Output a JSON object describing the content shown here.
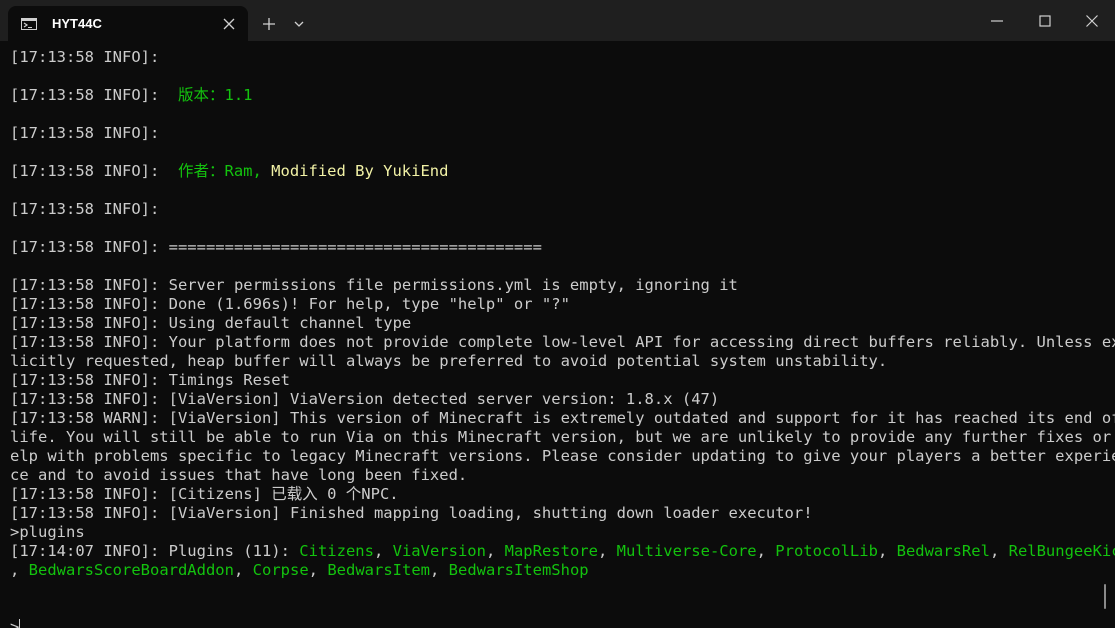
{
  "window": {
    "tab_title": "HYT44C",
    "icons": {
      "tab": "terminal-icon",
      "close_tab": "close-icon",
      "new_tab": "plus-icon",
      "dropdown": "chevron-down-icon",
      "minimize": "minimize-icon",
      "maximize": "maximize-icon",
      "close": "close-icon"
    }
  },
  "colors": {
    "background": "#0c0c0c",
    "titlebar": "#1f1f1f",
    "text": "#cccccc",
    "green": "#13c30e",
    "yellow": "#f2f2a6"
  },
  "terminal": {
    "lines": [
      [
        {
          "text": "[17:13:58 INFO]:"
        }
      ],
      [],
      [
        {
          "text": "[17:13:58 INFO]:  "
        },
        {
          "text": "版本：1.1",
          "color": "green"
        }
      ],
      [],
      [
        {
          "text": "[17:13:58 INFO]:"
        }
      ],
      [],
      [
        {
          "text": "[17:13:58 INFO]:  "
        },
        {
          "text": "作者：Ram, ",
          "color": "green"
        },
        {
          "text": "Modified By YukiEnd",
          "color": "yellow"
        }
      ],
      [],
      [
        {
          "text": "[17:13:58 INFO]:"
        }
      ],
      [],
      [
        {
          "text": "[17:13:58 INFO]: ========================================"
        }
      ],
      [],
      [
        {
          "text": "[17:13:58 INFO]: Server permissions file permissions.yml is empty, ignoring it"
        }
      ],
      [
        {
          "text": "[17:13:58 INFO]: Done (1.696s)! For help, type \"help\" or \"?\""
        }
      ],
      [
        {
          "text": "[17:13:58 INFO]: Using default channel type"
        }
      ],
      [
        {
          "text": "[17:13:58 INFO]: Your platform does not provide complete low-level API for accessing direct buffers reliably. Unless exp"
        }
      ],
      [
        {
          "text": "licitly requested, heap buffer will always be preferred to avoid potential system unstability."
        }
      ],
      [
        {
          "text": "[17:13:58 INFO]: Timings Reset"
        }
      ],
      [
        {
          "text": "[17:13:58 INFO]: [ViaVersion] ViaVersion detected server version: 1.8.x (47)"
        }
      ],
      [
        {
          "text": "[17:13:58 WARN]: [ViaVersion] This version of Minecraft is extremely outdated and support for it has reached its end of"
        }
      ],
      [
        {
          "text": "life. You will still be able to run Via on this Minecraft version, but we are unlikely to provide any further fixes or h"
        }
      ],
      [
        {
          "text": "elp with problems specific to legacy Minecraft versions. Please consider updating to give your players a better experien"
        }
      ],
      [
        {
          "text": "ce and to avoid issues that have long been fixed."
        }
      ],
      [
        {
          "text": "[17:13:58 INFO]: [Citizens] 已载入 0 个NPC."
        }
      ],
      [
        {
          "text": "[17:13:58 INFO]: [ViaVersion] Finished mapping loading, shutting down loader executor!"
        }
      ],
      [
        {
          "text": ">plugins"
        }
      ],
      [
        {
          "text": "[17:14:07 INFO]: Plugins (11): "
        },
        {
          "text": "Citizens",
          "color": "green"
        },
        {
          "text": ", "
        },
        {
          "text": "ViaVersion",
          "color": "green"
        },
        {
          "text": ", "
        },
        {
          "text": "MapRestore",
          "color": "green"
        },
        {
          "text": ", "
        },
        {
          "text": "Multiverse-Core",
          "color": "green"
        },
        {
          "text": ", "
        },
        {
          "text": "ProtocolLib",
          "color": "green"
        },
        {
          "text": ", "
        },
        {
          "text": "BedwarsRel",
          "color": "green"
        },
        {
          "text": ", "
        },
        {
          "text": "RelBungeeKick",
          "color": "green"
        }
      ],
      [
        {
          "text": ", "
        },
        {
          "text": "BedwarsScoreBoardAddon",
          "color": "green"
        },
        {
          "text": ", "
        },
        {
          "text": "Corpse",
          "color": "green"
        },
        {
          "text": ", "
        },
        {
          "text": "BedwarsItem",
          "color": "green"
        },
        {
          "text": ", "
        },
        {
          "text": "BedwarsItemShop",
          "color": "green"
        }
      ],
      [],
      [],
      [
        {
          "text": ">"
        }
      ]
    ]
  }
}
